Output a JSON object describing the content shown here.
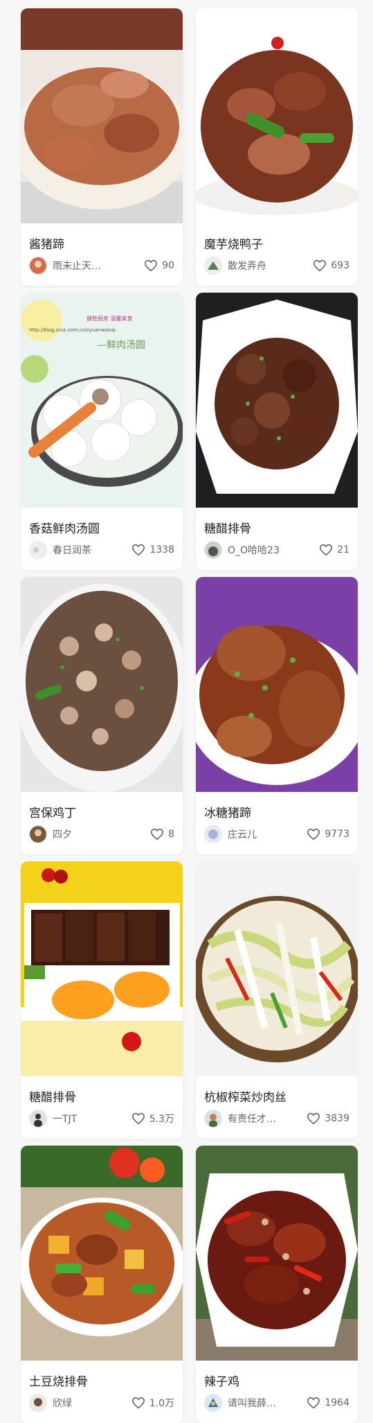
{
  "recipes": [
    {
      "title": "酱猪蹄",
      "author": "雨未止天…",
      "likes": "90",
      "avatar_color": "#d96a4a"
    },
    {
      "title": "魔芋烧鸭子",
      "author": "散发弄舟",
      "likes": "693",
      "avatar_color": "#5a7d5c"
    },
    {
      "title": "香菇鲜肉汤圆",
      "author": "春日润茶",
      "likes": "1338",
      "avatar_color": "#d8d8d8"
    },
    {
      "title": "糖醋排骨",
      "author": "O_O哈哈23",
      "likes": "21",
      "avatar_color": "#4a5a4a"
    },
    {
      "title": "宫保鸡丁",
      "author": "四夕",
      "likes": "8",
      "avatar_color": "#7a5a3a"
    },
    {
      "title": "冰糖猪蹄",
      "author": "庄云儿",
      "likes": "9773",
      "avatar_color": "#a9b4d6"
    },
    {
      "title": "糖醋排骨",
      "author": "一TJT",
      "likes": "5.3万",
      "avatar_color": "#333333"
    },
    {
      "title": "杭椒榨菜炒肉丝",
      "author": "有责任才…",
      "likes": "3839",
      "avatar_color": "#c08060"
    },
    {
      "title": "土豆烧排骨",
      "author": "欣绿",
      "likes": "1.0万",
      "avatar_color": "#6a5040"
    },
    {
      "title": "辣子鸡",
      "author": "请叫我薛…",
      "likes": "1964",
      "avatar_color": "#3a6aa0"
    }
  ],
  "photo_watermarks": {
    "card3_line1": "健胜厨房 温馨美食",
    "card3_line2": "http://blog.sina.com.cn/zyuanwanaj",
    "card3_caption": "—鲜肉汤圆"
  },
  "colors": {
    "page_bg": "#f7f7f7",
    "card_bg": "#ffffff",
    "title_text": "#222222",
    "meta_text": "#666666"
  }
}
